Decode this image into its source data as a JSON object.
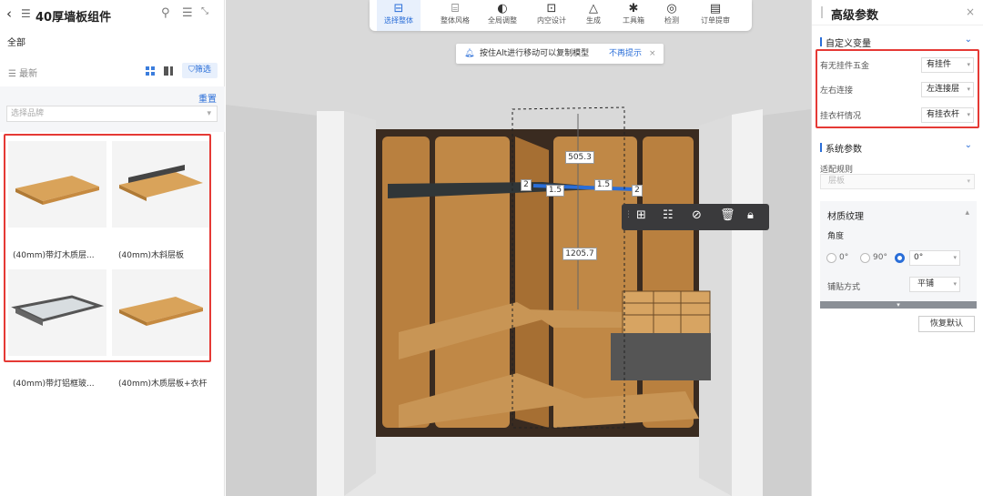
{
  "left_panel": {
    "title": "40厚墙板组件",
    "category_all": "全部",
    "sort_latest": "最新",
    "filter_label": "筛选",
    "reset_label": "重置",
    "brand_placeholder": "选择品牌",
    "products": [
      {
        "name": "(40mm)带灯木质层..."
      },
      {
        "name": "(40mm)木斜层板"
      },
      {
        "name": "(40mm)带灯铝框玻..."
      },
      {
        "name": "(40mm)木质层板+衣杆"
      }
    ]
  },
  "toolbar": {
    "items": [
      {
        "label": "选择整体",
        "icon": "select-whole-icon"
      },
      {
        "label": "整体风格",
        "icon": "style-brush-icon"
      },
      {
        "label": "全局调整",
        "icon": "palette-icon"
      },
      {
        "label": "内空设计",
        "icon": "inner-space-icon"
      },
      {
        "label": "生成",
        "icon": "generate-icon"
      },
      {
        "label": "工具箱",
        "icon": "toolbox-icon"
      },
      {
        "label": "检测",
        "icon": "detect-icon"
      },
      {
        "label": "订单提审",
        "icon": "order-icon"
      }
    ]
  },
  "notice": {
    "message": "按住Alt进行移动可以复制模型",
    "dismiss": "不再提示"
  },
  "viewport": {
    "dim_width": "505.3",
    "dim_height": "1205.7",
    "dim_a": "1.5",
    "dim_b": "1.5",
    "dim_left": "2",
    "dim_right": "2"
  },
  "right_panel": {
    "title": "高级参数",
    "custom_section": "自定义变量",
    "params": [
      {
        "label": "有无挂件五金",
        "value": "有挂件"
      },
      {
        "label": "左右连接",
        "value": "左连接层"
      },
      {
        "label": "挂衣杆情况",
        "value": "有挂衣杆"
      }
    ],
    "system_section": "系统参数",
    "adapt_rule_label": "适配规则",
    "adapt_rule_value": "层板",
    "material_section": "材质纹理",
    "angle_label": "角度",
    "angle_options": [
      "0°",
      "90°"
    ],
    "angle_value": "0°",
    "paving_label": "铺贴方式",
    "paving_value": "平铺",
    "restore_label": "恢复默认"
  }
}
